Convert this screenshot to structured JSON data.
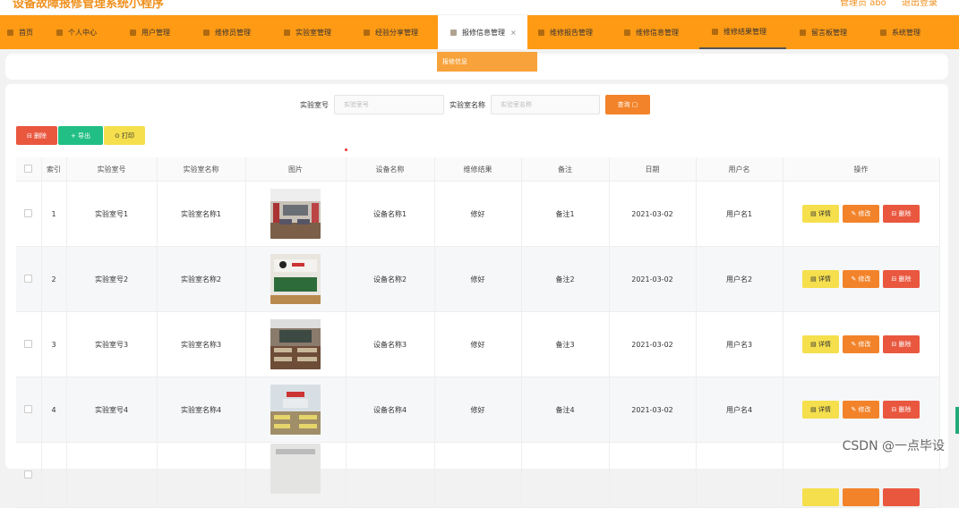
{
  "app": {
    "title": "设备故障报修管理系统小程序",
    "user": "管理员 abo",
    "logout": "退出登录"
  },
  "nav": {
    "items": [
      {
        "label": "首页"
      },
      {
        "label": "个人中心"
      },
      {
        "label": "用户管理"
      },
      {
        "label": "维修员管理"
      },
      {
        "label": "实验室管理"
      },
      {
        "label": "经验分享管理"
      },
      {
        "label": "报修信息管理"
      },
      {
        "label": "维修报告管理"
      },
      {
        "label": "维修信息管理"
      },
      {
        "label": "维修结果管理"
      },
      {
        "label": "留言板管理"
      },
      {
        "label": "系统管理"
      }
    ],
    "close": "×",
    "dropdown_item": "报修信息"
  },
  "search": {
    "label1": "实验室号",
    "placeholder1": "实验室号",
    "label2": "实验室名称",
    "placeholder2": "实验室名称",
    "button": "查询 ▢"
  },
  "actions": {
    "delete": "⊟ 删除",
    "export": "+ 导出",
    "print": "⊙ 打印"
  },
  "table": {
    "headers": [
      "",
      "索引",
      "实验室号",
      "实验室名称",
      "图片",
      "设备名称",
      "维修结果",
      "备注",
      "日期",
      "用户名",
      "操作"
    ],
    "rows": [
      {
        "idx": "1",
        "lab_no": "实验室号1",
        "lab_name": "实验室名称1",
        "device": "设备名称1",
        "result": "修好",
        "note": "备注1",
        "date": "2021-03-02",
        "user": "用户名1"
      },
      {
        "idx": "2",
        "lab_no": "实验室号2",
        "lab_name": "实验室名称2",
        "device": "设备名称2",
        "result": "修好",
        "note": "备注2",
        "date": "2021-03-02",
        "user": "用户名2"
      },
      {
        "idx": "3",
        "lab_no": "实验室号3",
        "lab_name": "实验室名称3",
        "device": "设备名称3",
        "result": "修好",
        "note": "备注3",
        "date": "2021-03-02",
        "user": "用户名3"
      },
      {
        "idx": "4",
        "lab_no": "实验室号4",
        "lab_name": "实验室名称4",
        "device": "设备名称4",
        "result": "修好",
        "note": "备注4",
        "date": "2021-03-02",
        "user": "用户名4"
      }
    ],
    "ops": {
      "detail": "▤ 详情",
      "edit": "✎ 修改",
      "del": "⊟ 删除"
    }
  },
  "watermark": "CSDN @一点毕设",
  "colors": {
    "nav": "#ff9a14",
    "accent": "#f2832a",
    "danger": "#e9573f",
    "success": "#21bf85",
    "warning": "#f5df4d"
  }
}
